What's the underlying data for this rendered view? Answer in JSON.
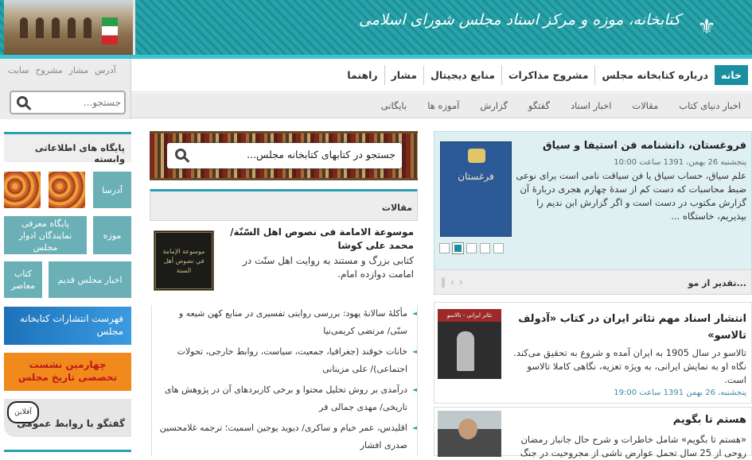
{
  "header": {
    "title": "کتابخانه، موزه و مرکز اسناد مجلس شورای اسلامی",
    "brand_color": "#239aa1"
  },
  "nav": {
    "items": [
      "خانه",
      "درباره کتابخانه مجلس",
      "مشروح مذاکرات",
      "منابع دیجیتال",
      "مشار",
      "راهنما"
    ]
  },
  "subnav": {
    "items": [
      "اخبار دنیای کتاب",
      "مقالات",
      "اخبار اسناد",
      "گفتگو",
      "گزارش",
      "آموزه ها",
      "بایگانی"
    ]
  },
  "top_links": [
    "آدرس",
    "مشار",
    "مشروح",
    "سایت"
  ],
  "search": {
    "placeholder": "جستجو..."
  },
  "left_sidebar": {
    "title": "پایگاه های اطلاعاتی وابسته",
    "tiles": [
      "آدرسا",
      "موزه",
      "پایگاه معرفی نمایندگان ادوار مجلس",
      "اخبار مجلس قدیم",
      "کتاب معاصر"
    ],
    "banner_publications": "فهرست انتشارات کتابخانه مجلس",
    "banner_session": "چهارمین نشست تخصصی تاریخ مجلس",
    "chat_label": "گفتگو با روابط عمومی",
    "chat_badge": "آفلاین"
  },
  "middle": {
    "library_search": "جستجو در کتابهای کتابخانه مجلس...",
    "articles_title": "مقالات",
    "featured": {
      "book_text": "موسوعة الإمامة في نصوص أهل السنة",
      "title": "موسوعة الامامة فی نصوص اهل السّنّة/ محمد علی کوشا",
      "desc": "کتابی بزرگ و مستند به روایت اهل سنّت در امامت دوازده امام."
    },
    "articles": [
      "مأکلهٔ سالانهٔ یهود: بررسی روایتی تفسیری در منابع کهن شیعه و سنّی/ مرتضی کریمی‌نیا",
      "خانات خوقند (جغرافیا، جمعیت، سیاست، روابط خارجی، تحولات اجتماعی)/ علی مزینانی",
      "درآمدی بر روش تحلیل محتوا و برخی کاربردهای آن در پژوهش های تاریخی/ مهدی جمالی فر",
      "اقلیدس، عمر خیام و ساکری/ دیوید یوجین اسمیت؛ ترجمه غلامحسین صدری افشار"
    ]
  },
  "right": {
    "feature": {
      "book_title": "فرغستان",
      "title": "فروغستان، دانشنامه فن استیفا و سیاق",
      "date": "پنجشنبه 26 بهمن، 1391 ساعت 10:00",
      "text": "علم سیاق، حساب سیاق یا فن سیاقت نامی است برای نوعی ضبط محاسبات که دست کم از سدهٔ چهارم هجری دربارهٔ آن گزارش مکتوب در دست است و اگر گزارش ابن ندیم را بپذیریم، خاستگاه ..."
    },
    "slides": 5,
    "active_slide": 4,
    "taqdir_title": "تقدیر از مو...",
    "news": [
      {
        "img_caption": "تئاتر ایرانی - تالاسو",
        "title": "انتشار اسناد مهم تئاتر ایران در کتاب «آدولف تالاسو»",
        "text": "تالاسو در سال 1905 به ایران آمده و شروع به تحقیق می‌کند. نگاه او به نمایش ایرانی، به ویژه تعزیه، نگاهی کاملا تالاسو است.",
        "date": "پنجشنبه، 26 بهمن 1391 ساعت 19:00"
      },
      {
        "title": "هستم تا بگویم",
        "text": "«هستم تا بگویم» شامل خاطرات و شرح حال جانباز رمضان روحی از 25 سال تحمل عوارض ناشی از مجروحیت در جنگ"
      }
    ]
  }
}
